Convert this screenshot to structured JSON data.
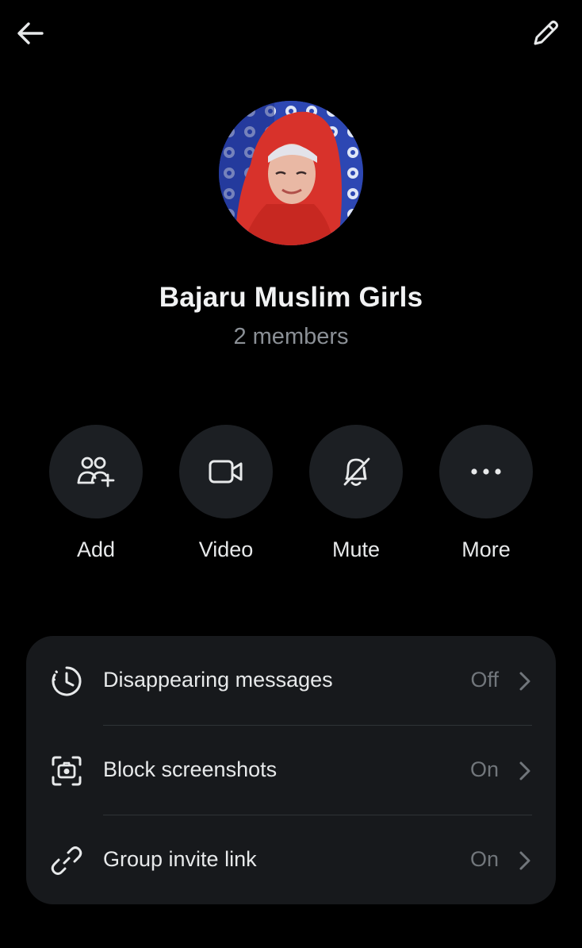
{
  "header": {
    "back_icon": "arrow-left-icon",
    "edit_icon": "pencil-icon"
  },
  "group": {
    "name": "Bajaru Muslim Girls",
    "members": "2 members"
  },
  "actions": [
    {
      "label": "Add",
      "icon": "add-people-icon"
    },
    {
      "label": "Video",
      "icon": "video-camera-icon"
    },
    {
      "label": "Mute",
      "icon": "bell-muted-icon"
    },
    {
      "label": "More",
      "icon": "more-dots-icon"
    }
  ],
  "settings": [
    {
      "label": "Disappearing messages",
      "value": "Off",
      "icon": "timer-icon"
    },
    {
      "label": "Block screenshots",
      "value": "On",
      "icon": "screenshot-camera-icon"
    },
    {
      "label": "Group invite link",
      "value": "On",
      "icon": "link-icon"
    }
  ],
  "colors": {
    "background": "#000000",
    "surface": "#17191c",
    "button_bg": "#1c1f23",
    "text_primary": "#e7e9ea",
    "text_secondary": "#71767b"
  }
}
